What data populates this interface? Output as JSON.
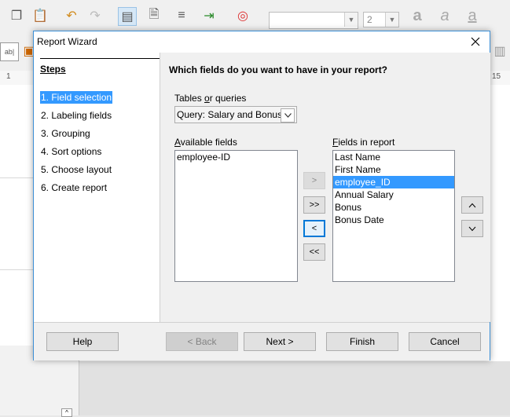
{
  "dialog": {
    "title": "Report Wizard",
    "steps_title": "Steps",
    "steps": [
      {
        "label": "1. Field selection",
        "active": true
      },
      {
        "label": "2. Labeling fields",
        "active": false
      },
      {
        "label": "3. Grouping",
        "active": false
      },
      {
        "label": "4. Sort options",
        "active": false
      },
      {
        "label": "5. Choose layout",
        "active": false
      },
      {
        "label": "6. Create report",
        "active": false
      }
    ],
    "question": "Which fields do you want to have in your report?",
    "tables_label_pre": "Tables ",
    "tables_label_u": "o",
    "tables_label_post": "r queries",
    "tables_value": "Query: Salary and Bonus",
    "available_label_u": "A",
    "available_label_post": "vailable fields",
    "fields_label_u": "F",
    "fields_label_post": "ields in report",
    "available_fields": [
      "employee-ID"
    ],
    "report_fields": [
      "Last Name",
      "First Name",
      "employee_ID",
      "Annual Salary",
      "Bonus",
      "Bonus Date"
    ],
    "selected_report_field": "employee_ID",
    "move_buttons": [
      ">",
      ">>",
      "<",
      "<<"
    ],
    "order_buttons": [
      "^",
      "v"
    ],
    "footer_buttons": {
      "help": "Help",
      "back": "< Back",
      "next": "Next >",
      "finish": "Finish",
      "cancel": "Cancel"
    }
  },
  "background": {
    "font_size_value": "2",
    "ruler_right_number": "15",
    "ruler_left_number": "1"
  },
  "colors": {
    "accent": "#3399ff",
    "dialog_border": "#3c8fd6"
  }
}
